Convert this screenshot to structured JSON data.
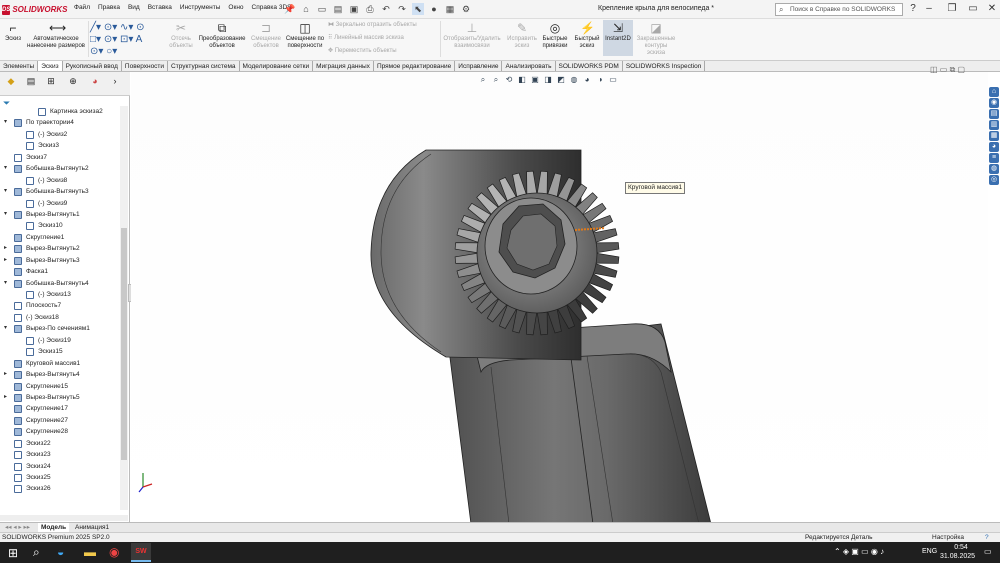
{
  "app": {
    "brand": "SOLIDWORKS",
    "doc_title": "Крепление крыла для велосипеда *",
    "search_placeholder": "Поиск в Справке по SOLIDWORKS"
  },
  "menu": [
    "Файл",
    "Правка",
    "Вид",
    "Вставка",
    "Инструменты",
    "Окно",
    "Справка 3DS"
  ],
  "ribbon": {
    "sketch": "Эскиз",
    "smart_dim": "Автоматическое нанесение размеров",
    "trim": "Отсечь объекты",
    "convert": "Преобразование объектов",
    "offset": "Смещение объектов",
    "offset_surface": "Смещение по поверхности",
    "mirror": "Зеркально отразить объекты",
    "linear_pattern": "Линейный массив эскиза",
    "move": "Переместить объекты",
    "display_relations": "Отобразить/Удалить взаимосвязи",
    "repair": "Исправить эскиз",
    "quick_snaps": "Быстрые привязки",
    "rapid_sketch": "Быстрый эскиз",
    "instant2d": "Instant2D",
    "shaded_contours": "Закрашенные контуры эскиза"
  },
  "tabs": [
    "Элементы",
    "Эскиз",
    "Рукописный ввод",
    "Поверхности",
    "Структурная система",
    "Моделирование сетки",
    "Миграция данных",
    "Прямое редактирование",
    "Исправление",
    "Анализировать",
    "SOLIDWORKS PDM",
    "SOLIDWORKS Inspection"
  ],
  "active_tab": "Эскиз",
  "tree": [
    {
      "label": "Картинка эскиза2",
      "level": 2
    },
    {
      "label": "По траектории4",
      "level": 0,
      "expand": "▾"
    },
    {
      "label": "(-) Эскиз2",
      "level": 1
    },
    {
      "label": "Эскиз3",
      "level": 1
    },
    {
      "label": "Эскиз7",
      "level": 0
    },
    {
      "label": "Бобышка-Вытянуть2",
      "level": 0,
      "expand": "▾"
    },
    {
      "label": "(-) Эскиз8",
      "level": 1
    },
    {
      "label": "Бобышка-Вытянуть3",
      "level": 0,
      "expand": "▾"
    },
    {
      "label": "(-) Эскиз9",
      "level": 1
    },
    {
      "label": "Вырез-Вытянуть1",
      "level": 0,
      "expand": "▾"
    },
    {
      "label": "Эскиз10",
      "level": 1
    },
    {
      "label": "Скругление1",
      "level": 0
    },
    {
      "label": "Вырез-Вытянуть2",
      "level": 0,
      "expand": "▸"
    },
    {
      "label": "Вырез-Вытянуть3",
      "level": 0,
      "expand": "▸"
    },
    {
      "label": "Фаска1",
      "level": 0
    },
    {
      "label": "Бобышка-Вытянуть4",
      "level": 0,
      "expand": "▾"
    },
    {
      "label": "(-) Эскиз13",
      "level": 1
    },
    {
      "label": "Плоскость7",
      "level": 0
    },
    {
      "label": "(-) Эскиз18",
      "level": 0
    },
    {
      "label": "Вырез-По сечениям1",
      "level": 0,
      "expand": "▾"
    },
    {
      "label": "(-) Эскиз19",
      "level": 1
    },
    {
      "label": "Эскиз15",
      "level": 1
    },
    {
      "label": "Круговой массив1",
      "level": 0
    },
    {
      "label": "Вырез-Вытянуть4",
      "level": 0,
      "expand": "▸"
    },
    {
      "label": "Скругление15",
      "level": 0
    },
    {
      "label": "Вырез-Вытянуть5",
      "level": 0,
      "expand": "▸"
    },
    {
      "label": "Скругление17",
      "level": 0
    },
    {
      "label": "Скругление27",
      "level": 0
    },
    {
      "label": "Скругление28",
      "level": 0
    },
    {
      "label": "Эскиз22",
      "level": 0
    },
    {
      "label": "Эскиз23",
      "level": 0
    },
    {
      "label": "Эскиз24",
      "level": 0
    },
    {
      "label": "Эскиз25",
      "level": 0
    },
    {
      "label": "Эскиз26",
      "level": 0
    }
  ],
  "tooltip": "Круговой массив1",
  "bottom_tabs": [
    "Модель",
    "Анимация1"
  ],
  "status": {
    "left": "SOLIDWORKS Premium 2025 SP2.0",
    "middle": "Редактируется Деталь",
    "right": "Настройка"
  },
  "taskbar": {
    "lang": "ENG",
    "time": "0:54",
    "date": "31.08.2025"
  },
  "colors": {
    "accent": "#c8102e",
    "viewport_bg": "#ffffff",
    "model": "#4a4a4a"
  }
}
